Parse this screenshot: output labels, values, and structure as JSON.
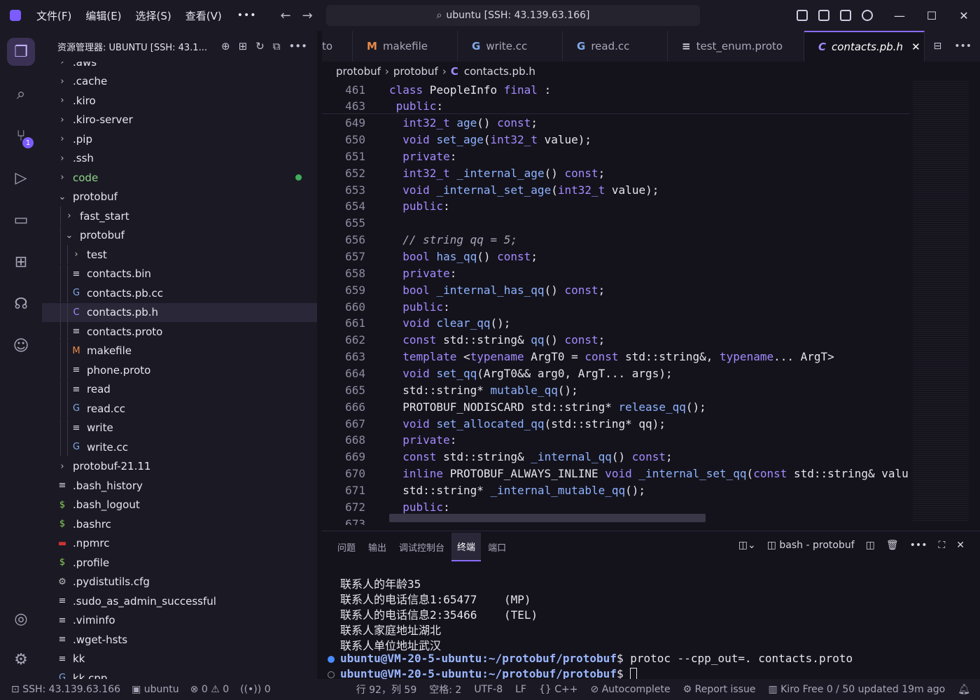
{
  "menu": [
    "文件(F)",
    "编辑(E)",
    "选择(S)",
    "查看(V)"
  ],
  "title": "ubuntu [SSH: 43.139.63.166]",
  "sidebar": {
    "title": "资源管理器: UBUNTU [SSH: 43.1...",
    "items": [
      {
        "label": ".aws",
        "depth": 0,
        "kind": "folder",
        "open": false
      },
      {
        "label": ".cache",
        "depth": 0,
        "kind": "folder",
        "open": false
      },
      {
        "label": ".kiro",
        "depth": 0,
        "kind": "folder",
        "open": false
      },
      {
        "label": ".kiro-server",
        "depth": 0,
        "kind": "folder",
        "open": false
      },
      {
        "label": ".pip",
        "depth": 0,
        "kind": "folder",
        "open": false
      },
      {
        "label": ".ssh",
        "depth": 0,
        "kind": "folder",
        "open": false
      },
      {
        "label": "code",
        "depth": 0,
        "kind": "folder",
        "open": false,
        "green": true
      },
      {
        "label": "protobuf",
        "depth": 0,
        "kind": "folder",
        "open": true
      },
      {
        "label": "fast_start",
        "depth": 1,
        "kind": "folder",
        "open": false
      },
      {
        "label": "protobuf",
        "depth": 1,
        "kind": "folder",
        "open": true
      },
      {
        "label": "test",
        "depth": 2,
        "kind": "folder",
        "open": false
      },
      {
        "label": "contacts.bin",
        "depth": 2,
        "kind": "text"
      },
      {
        "label": "contacts.pb.cc",
        "depth": 2,
        "kind": "cpp"
      },
      {
        "label": "contacts.pb.h",
        "depth": 2,
        "kind": "c",
        "selected": true
      },
      {
        "label": "contacts.proto",
        "depth": 2,
        "kind": "text"
      },
      {
        "label": "makefile",
        "depth": 2,
        "kind": "make"
      },
      {
        "label": "phone.proto",
        "depth": 2,
        "kind": "text"
      },
      {
        "label": "read",
        "depth": 2,
        "kind": "text"
      },
      {
        "label": "read.cc",
        "depth": 2,
        "kind": "cpp"
      },
      {
        "label": "write",
        "depth": 2,
        "kind": "text"
      },
      {
        "label": "write.cc",
        "depth": 2,
        "kind": "cpp"
      },
      {
        "label": "protobuf-21.11",
        "depth": 0,
        "kind": "folder",
        "open": false
      },
      {
        "label": ".bash_history",
        "depth": 0,
        "kind": "text"
      },
      {
        "label": ".bash_logout",
        "depth": 0,
        "kind": "shell"
      },
      {
        "label": ".bashrc",
        "depth": 0,
        "kind": "shell"
      },
      {
        "label": ".npmrc",
        "depth": 0,
        "kind": "npm"
      },
      {
        "label": ".profile",
        "depth": 0,
        "kind": "shell"
      },
      {
        "label": ".pydistutils.cfg",
        "depth": 0,
        "kind": "gear"
      },
      {
        "label": ".sudo_as_admin_successful",
        "depth": 0,
        "kind": "text"
      },
      {
        "label": ".viminfo",
        "depth": 0,
        "kind": "text"
      },
      {
        "label": ".wget-hsts",
        "depth": 0,
        "kind": "text"
      },
      {
        "label": "kk",
        "depth": 0,
        "kind": "text"
      },
      {
        "label": "kk.cpp",
        "depth": 0,
        "kind": "cpp"
      }
    ]
  },
  "tabs": [
    {
      "label": "to",
      "icon": ""
    },
    {
      "label": "makefile",
      "icon": "M"
    },
    {
      "label": "write.cc",
      "icon": "G"
    },
    {
      "label": "read.cc",
      "icon": "G"
    },
    {
      "label": "test_enum.proto",
      "icon": "≡"
    },
    {
      "label": "contacts.pb.h",
      "icon": "C",
      "active": true
    }
  ],
  "breadcrumb": [
    "protobuf",
    "protobuf",
    "contacts.pb.h"
  ],
  "breadcrumb_icon": "C",
  "code": [
    {
      "n": "461",
      "t": "class PeopleInfo final :"
    },
    {
      "n": "463",
      "t": " public:"
    },
    {
      "n": "649",
      "t": "  int32_t age() const;"
    },
    {
      "n": "650",
      "t": "  void set_age(int32_t value);"
    },
    {
      "n": "651",
      "t": "  private:"
    },
    {
      "n": "652",
      "t": "  int32_t _internal_age() const;"
    },
    {
      "n": "653",
      "t": "  void _internal_set_age(int32_t value);"
    },
    {
      "n": "654",
      "t": "  public:"
    },
    {
      "n": "655",
      "t": ""
    },
    {
      "n": "656",
      "t": "  // string qq = 5;"
    },
    {
      "n": "657",
      "t": "  bool has_qq() const;"
    },
    {
      "n": "658",
      "t": "  private:"
    },
    {
      "n": "659",
      "t": "  bool _internal_has_qq() const;"
    },
    {
      "n": "660",
      "t": "  public:"
    },
    {
      "n": "661",
      "t": "  void clear_qq();"
    },
    {
      "n": "662",
      "t": "  const std::string& qq() const;"
    },
    {
      "n": "663",
      "t": "  template <typename ArgT0 = const std::string&, typename... ArgT>"
    },
    {
      "n": "664",
      "t": "  void set_qq(ArgT0&& arg0, ArgT... args);"
    },
    {
      "n": "665",
      "t": "  std::string* mutable_qq();"
    },
    {
      "n": "666",
      "t": "  PROTOBUF_NODISCARD std::string* release_qq();"
    },
    {
      "n": "667",
      "t": "  void set_allocated_qq(std::string* qq);"
    },
    {
      "n": "668",
      "t": "  private:"
    },
    {
      "n": "669",
      "t": "  const std::string& _internal_qq() const;"
    },
    {
      "n": "670",
      "t": "  inline PROTOBUF_ALWAYS_INLINE void _internal_set_qq(const std::string& valu"
    },
    {
      "n": "671",
      "t": "  std::string* _internal_mutable_qq();"
    },
    {
      "n": "672",
      "t": "  public:"
    },
    {
      "n": "673",
      "t": ""
    }
  ],
  "panel": {
    "tabs": [
      "问题",
      "输出",
      "调试控制台",
      "终端",
      "端口"
    ],
    "active": "终端",
    "terminal_name": "bash - protobuf"
  },
  "terminal": {
    "lines": [
      "联系人的年龄35",
      "联系人的电话信息1:65477    (MP)",
      "联系人的电话信息2:35466    (TEL)",
      "联系人家庭地址湖北",
      "联系人单位地址武汉"
    ],
    "prompt1": "ubuntu@VM-20-5-ubuntu:~/protobuf/protobuf",
    "cmd1": "$ protoc --cpp_out=. contacts.proto",
    "prompt2": "ubuntu@VM-20-5-ubuntu:~/protobuf/protobuf",
    "cmd2": "$ "
  },
  "status": {
    "ssh": "SSH: 43.139.63.166",
    "host": "ubuntu",
    "errors": "0",
    "warnings": "0",
    "ports": "0",
    "position": "行 92，列 59",
    "spaces": "空格: 2",
    "encoding": "UTF-8",
    "eol": "LF",
    "lang": "{} C++",
    "autocomplete": "Autocomplete",
    "report": "Report issue",
    "kiro": "Kiro Free 0 / 50 updated 19m ago"
  },
  "colors": {
    "accent": "#8a6cff",
    "bg": "#14131c",
    "panel": "#1b1a24"
  }
}
